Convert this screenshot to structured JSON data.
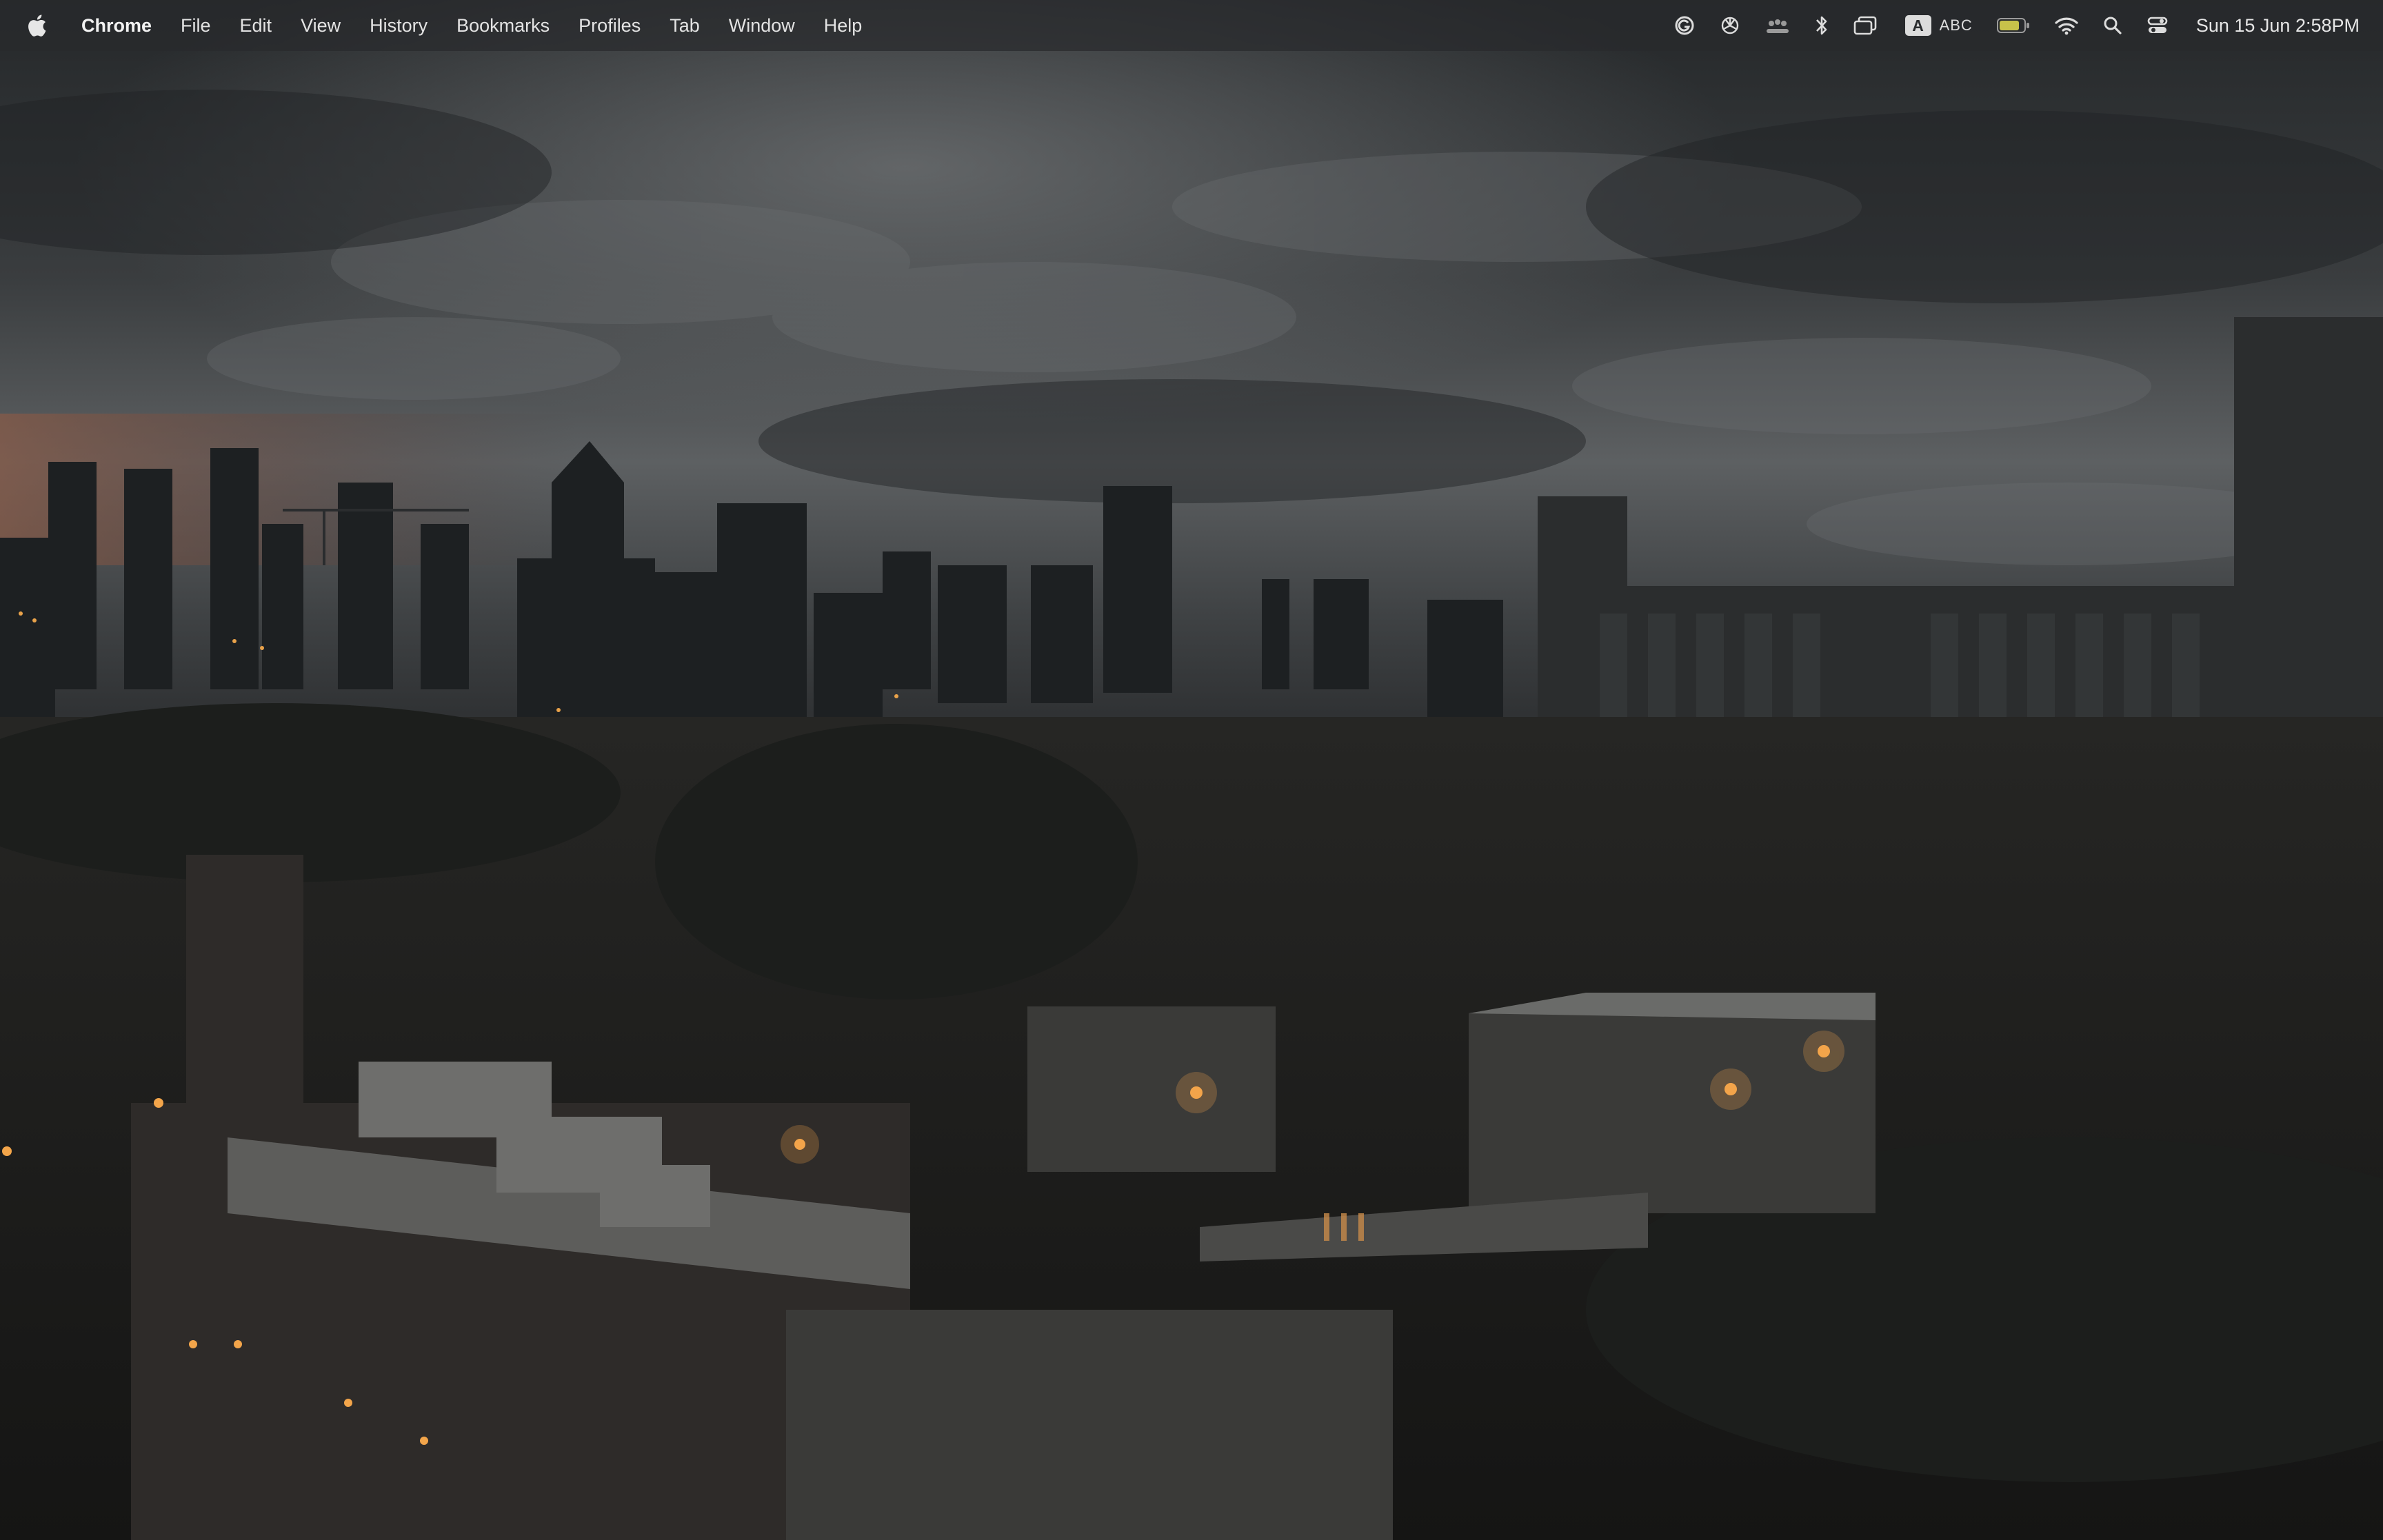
{
  "menubar": {
    "apple_icon": "apple-logo-icon",
    "app_name": "Chrome",
    "menus": [
      "File",
      "Edit",
      "View",
      "History",
      "Bookmarks",
      "Profiles",
      "Tab",
      "Window",
      "Help"
    ],
    "status_icons": [
      "grammarly-icon",
      "openai-icon",
      "meeting-icon",
      "bluetooth-icon",
      "screen-mirror-icon",
      "input-source-icon",
      "battery-icon",
      "wifi-icon",
      "search-icon",
      "control-center-icon"
    ],
    "input_source_letter": "A",
    "input_source_label": "ABC",
    "datetime": "Sun 15 Jun  2:58PM"
  },
  "wallpaper": {
    "subject": "night-city-skyline-icon"
  },
  "colors": {
    "menubar_bg": "#2a2c2e",
    "menubar_text": "#e6e6e6",
    "sky_dark": "#2b2e30",
    "city_light": "#f0a040"
  }
}
